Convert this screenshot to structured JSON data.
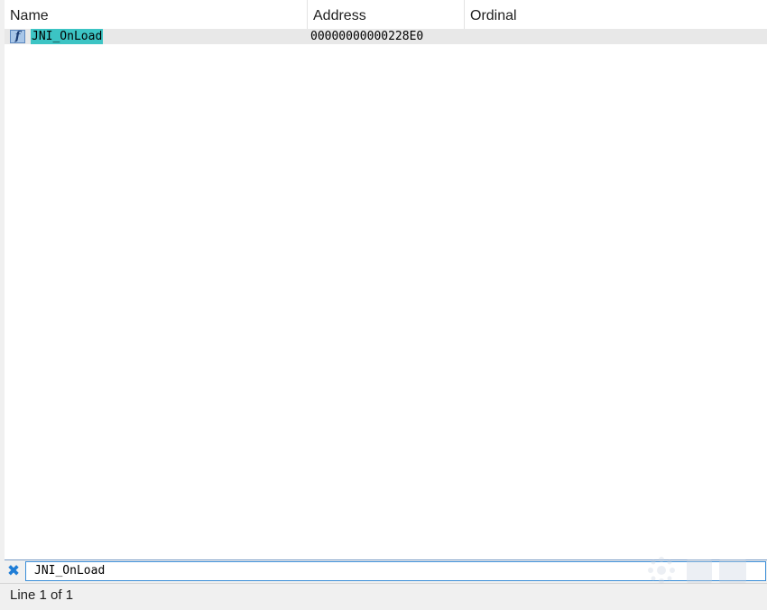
{
  "columns": {
    "name": "Name",
    "address": "Address",
    "ordinal": "Ordinal"
  },
  "rows": [
    {
      "icon": "function-icon",
      "name": "JNI_OnLoad",
      "address": "00000000000228E0",
      "ordinal": ""
    }
  ],
  "search": {
    "value": "JNI_OnLoad",
    "clear_icon": "close-icon"
  },
  "status": {
    "text": "Line 1 of 1"
  },
  "colors": {
    "highlight": "#3cc4c4",
    "accent": "#1f7dd6"
  }
}
